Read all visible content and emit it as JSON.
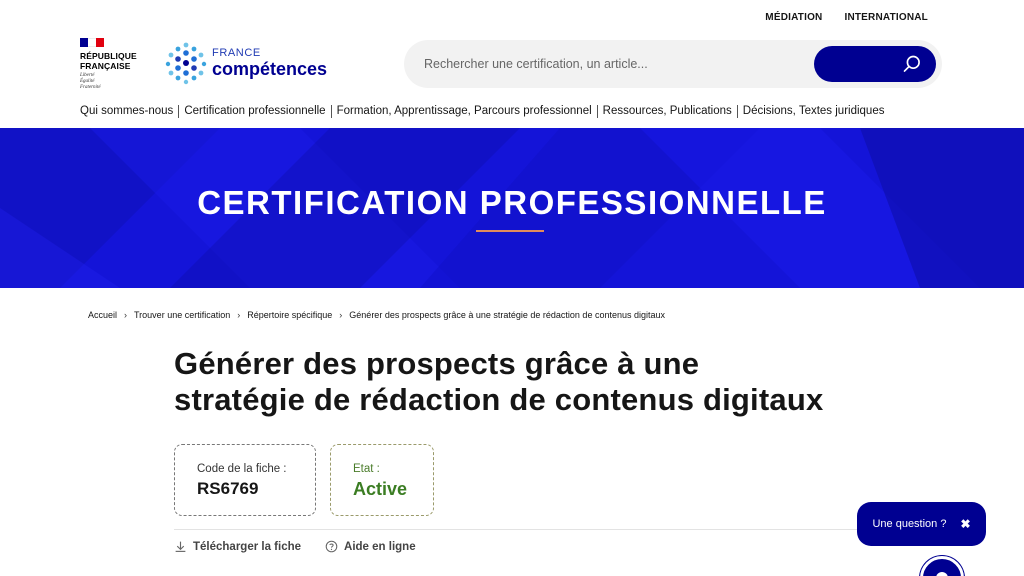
{
  "header": {
    "top_links": [
      "MÉDIATION",
      "INTERNATIONAL"
    ],
    "rf_logo": {
      "name_line1": "RÉPUBLIQUE",
      "name_line2": "FRANÇAISE",
      "motto": [
        "Liberté",
        "Égalité",
        "Fraternité"
      ],
      "flag_colors": [
        "#000091",
        "#ffffff",
        "#e1000f"
      ]
    },
    "fc_logo": {
      "line1": "FRANCE",
      "line2": "compétences"
    },
    "search": {
      "placeholder": "Rechercher une certification, un article...",
      "button_icon": "search-icon"
    }
  },
  "nav": {
    "items": [
      "Qui sommes-nous",
      "Certification professionnelle",
      "Formation, Apprentissage, Parcours professionnel",
      "Ressources, Publications",
      "Décisions, Textes juridiques"
    ]
  },
  "hero": {
    "title": "CERTIFICATION PROFESSIONNELLE",
    "accent_color": "#1414d8"
  },
  "breadcrumb": [
    "Accueil",
    "Trouver une certification",
    "Répertoire spécifique",
    "Générer des prospects grâce à une stratégie de rédaction de contenus digitaux"
  ],
  "page": {
    "title_line1": "Générer des prospects grâce à une",
    "title_line2": "stratégie de rédaction de contenus digitaux",
    "code_card": {
      "label": "Code de la fiche :",
      "value": "RS6769"
    },
    "state_card": {
      "label": "Etat :",
      "value": "Active",
      "color": "#3b7d23"
    },
    "actions": [
      {
        "label": "Télécharger la fiche",
        "icon": "download-icon"
      },
      {
        "label": "Aide en ligne",
        "icon": "help-icon"
      }
    ]
  },
  "widget": {
    "question_label": "Une question ?",
    "close_glyph": "✖"
  }
}
